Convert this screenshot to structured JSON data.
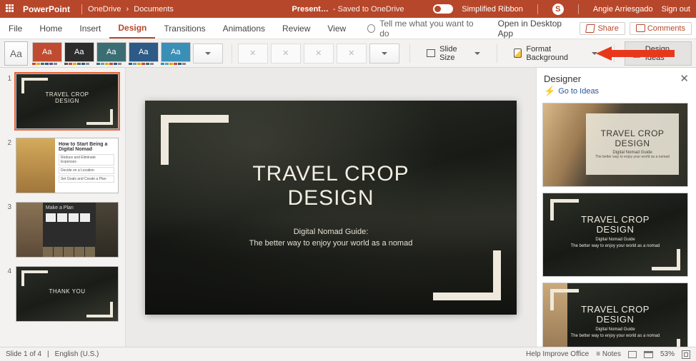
{
  "titlebar": {
    "app": "PowerPoint",
    "crumb1": "OneDrive",
    "crumb2": "Documents",
    "docname": "Present…",
    "saved": "- Saved to OneDrive",
    "simplified": "Simplified Ribbon",
    "user": "Angie Arriesgado",
    "signout": "Sign out"
  },
  "tabs": {
    "items": [
      "File",
      "Home",
      "Insert",
      "Design",
      "Transitions",
      "Animations",
      "Review",
      "View"
    ],
    "active": "Design",
    "tellme": "Tell me what you want to do",
    "openapp": "Open in Desktop App",
    "share": "Share",
    "comments": "Comments"
  },
  "ribbon": {
    "slidesize": "Slide Size",
    "formatbg": "Format Background",
    "designideas": "Design Ideas"
  },
  "thumbs": {
    "slide1": {
      "line1": "TRAVEL CROP",
      "line2": "DESIGN"
    },
    "slide2": {
      "heading": "How to Start Being a Digital Nomad",
      "r1": "Reduce and Eliminate Expenses",
      "r2": "Decide on a Location",
      "r3": "Set Goals and Create a Plan"
    },
    "slide3": {
      "heading": "Make a Plan"
    },
    "slide4": {
      "line1": "THANK YOU"
    }
  },
  "slide": {
    "title_l1": "TRAVEL CROP",
    "title_l2": "DESIGN",
    "sub1": "Digital Nomad Guide:",
    "sub2": "The better way to enjoy your world as a nomad"
  },
  "designer": {
    "title": "Designer",
    "goto": "Go to Ideas",
    "sugg": {
      "t1": "TRAVEL CROP",
      "t2": "DESIGN",
      "s1": "Digital Nomad Guide",
      "s2": "The better way to enjoy your world as a nomad"
    }
  },
  "status": {
    "slide": "Slide 1 of 4",
    "lang": "English (U.S.)",
    "help": "Help Improve Office",
    "notes": "Notes",
    "zoom": "53%"
  },
  "colors": {
    "brand": "#b7472a",
    "accent_arrow": "#e8381b"
  }
}
